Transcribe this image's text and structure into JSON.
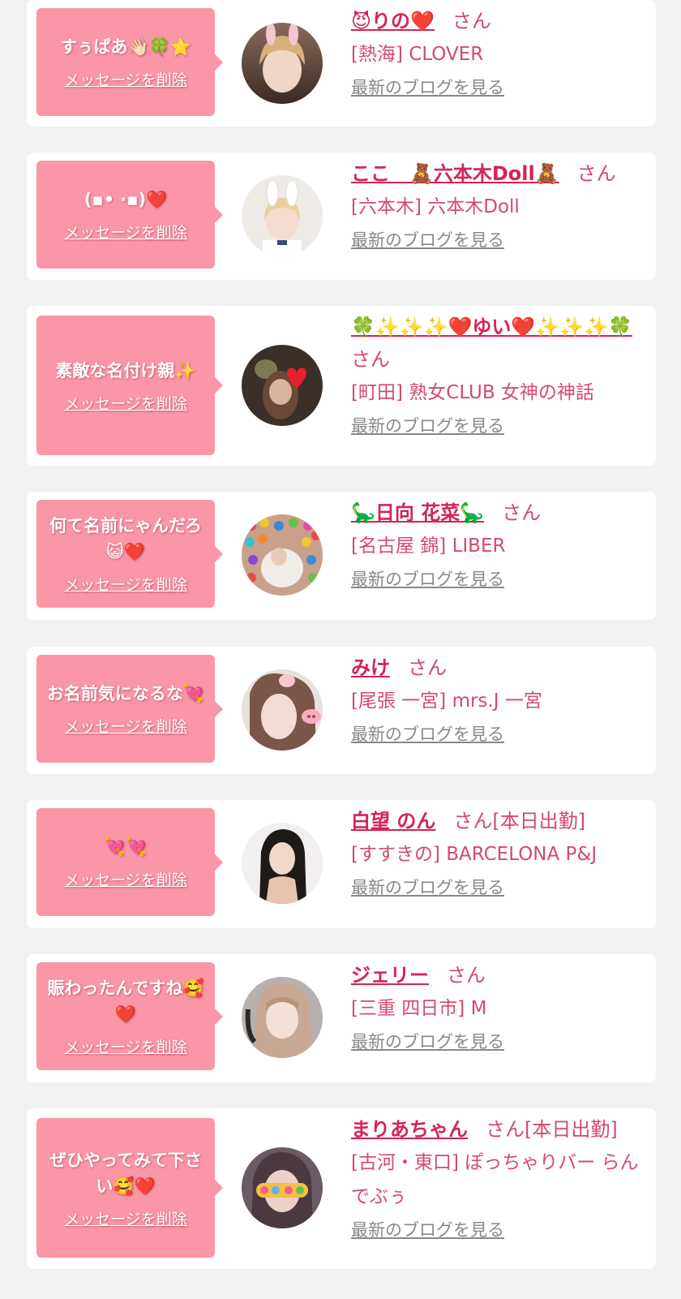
{
  "delete_label": "メッセージを削除",
  "blog_label": "最新のブログを見る",
  "colors": {
    "bubble": "#fa96a5",
    "name": "#d42456",
    "text": "#d44a6c",
    "link_gray": "#888888"
  },
  "items": [
    {
      "message": "すぅぱあ👋🏻🍀⭐",
      "name": "😈りの❤️",
      "suffix": "さん",
      "shop": "[熱海] CLOVER"
    },
    {
      "message": "(▪︎• ·▪︎)❤️",
      "name": "ここ　🧸六本木Doll🧸",
      "suffix": "さん",
      "shop": "[六本木] 六本木Doll"
    },
    {
      "message": "素敵な名付け親✨",
      "name": "🍀✨✨✨❤️ゆい❤️✨✨✨🍀",
      "suffix": "さん",
      "shop": "[町田] 熟女CLUB 女神の神話"
    },
    {
      "message": "何て名前にゃんだろ😺❤️",
      "name": "🦕日向 花菜🦕",
      "suffix": "さん",
      "shop": "[名古屋 錦] LIBER"
    },
    {
      "message": "お名前気になるな💘",
      "name": "みけ",
      "suffix": "さん",
      "shop": "[尾張 一宮] mrs.J 一宮"
    },
    {
      "message": "💘💘",
      "name": "白望 のん",
      "suffix": "さん[本日出勤]",
      "shop": "[すすきの] BARCELONA P&J"
    },
    {
      "message": "賑わったんですね🥰❤️",
      "name": "ジェリー",
      "suffix": "さん",
      "shop": "[三重 四日市] M"
    },
    {
      "message": "ぜひやってみて下さい🥰❤️",
      "name": "まりあちゃん",
      "suffix": "さん[本日出勤]",
      "shop": "[古河・東口] ぽっちゃりバー らんでぶぅ"
    }
  ]
}
